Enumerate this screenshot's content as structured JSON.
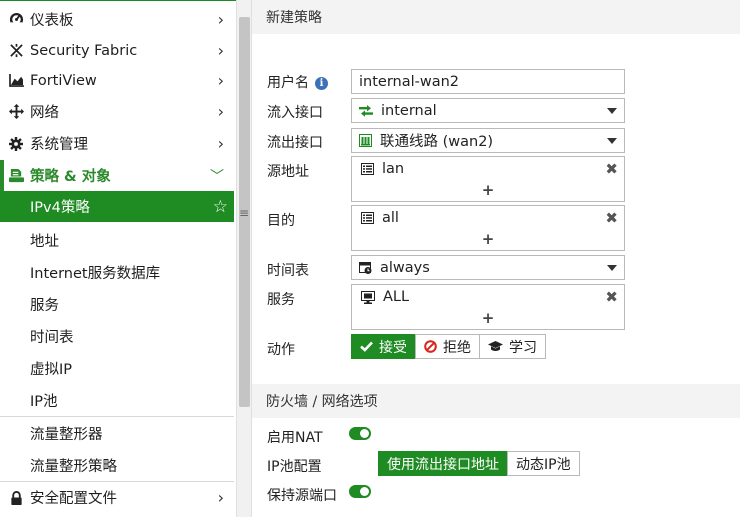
{
  "sidebar": {
    "items": [
      {
        "label": "仪表板",
        "icon": "dashboard-icon"
      },
      {
        "label": "Security Fabric",
        "icon": "security-fabric-icon"
      },
      {
        "label": "FortiView",
        "icon": "fortiview-chart-icon"
      },
      {
        "label": "网络",
        "icon": "network-arrows-icon"
      },
      {
        "label": "系统管理",
        "icon": "gear-icon"
      },
      {
        "label": "策略 & 对象",
        "icon": "policy-objects-icon"
      },
      {
        "label": "IPv4策略"
      },
      {
        "label": "地址"
      },
      {
        "label": "Internet服务数据库"
      },
      {
        "label": "服务"
      },
      {
        "label": "时间表"
      },
      {
        "label": "虚拟IP"
      },
      {
        "label": "IP池"
      },
      {
        "label": "流量整形器"
      },
      {
        "label": "流量整形策略"
      },
      {
        "label": "安全配置文件",
        "icon": "lock-icon"
      }
    ]
  },
  "main": {
    "title": "新建策略",
    "form": {
      "name_label": "用户名",
      "name_value": "internal-wan2",
      "incoming_label": "流入接口",
      "incoming_value": "internal",
      "outgoing_label": "流出接口",
      "outgoing_value": "联通线路 (wan2)",
      "source_label": "源地址",
      "source_value": "lan",
      "dest_label": "目的",
      "dest_value": "all",
      "schedule_label": "时间表",
      "schedule_value": "always",
      "service_label": "服务",
      "service_value": "ALL",
      "action_label": "动作",
      "action_options": [
        "接受",
        "拒绝",
        "学习"
      ],
      "action_selected": "接受"
    },
    "firewall_section": {
      "title": "防火墙 / 网络选项",
      "nat_label": "启用NAT",
      "nat_enabled": true,
      "ippool_label": "IP池配置",
      "ippool_options": [
        "使用流出接口地址",
        "动态IP池"
      ],
      "ippool_selected": "使用流出接口地址",
      "preserve_port_label": "保持源端口",
      "preserve_port_enabled": true
    }
  },
  "colors": {
    "accent": "#1e8b23",
    "section_bg": "#f3f3f3",
    "info_blue": "#3a72b8"
  }
}
